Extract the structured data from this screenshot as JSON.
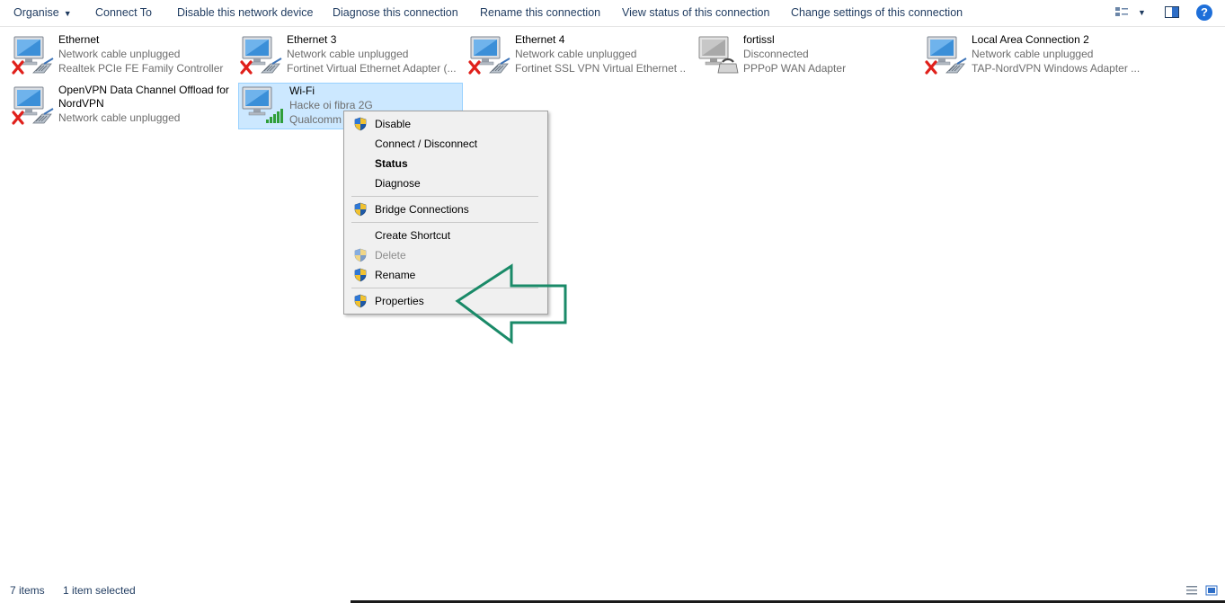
{
  "toolbar": {
    "organise": "Organise",
    "connect_to": "Connect To",
    "disable_device": "Disable this network device",
    "diagnose": "Diagnose this connection",
    "rename": "Rename this connection",
    "view_status": "View status of this connection",
    "change_settings": "Change settings of this connection",
    "help": "?"
  },
  "items": [
    {
      "name": "Ethernet",
      "status": "Network cable unplugged",
      "device": "Realtek PCIe FE Family Controller"
    },
    {
      "name": "Ethernet 3",
      "status": "Network cable unplugged",
      "device": "Fortinet Virtual Ethernet Adapter (..."
    },
    {
      "name": "Ethernet 4",
      "status": "Network cable unplugged",
      "device": "Fortinet SSL VPN Virtual Ethernet ..."
    },
    {
      "name": "fortissl",
      "status": "Disconnected",
      "device": "PPPoP WAN Adapter"
    },
    {
      "name": "Local Area Connection 2",
      "status": "Network cable unplugged",
      "device": "TAP-NordVPN Windows Adapter ..."
    },
    {
      "name": "OpenVPN Data Channel Offload for NordVPN",
      "status": "Network cable unplugged",
      "device": ""
    },
    {
      "name": "Wi-Fi",
      "status": "Hacke oi fibra 2G",
      "device": "Qualcomm"
    }
  ],
  "context_menu": {
    "disable": "Disable",
    "connect_disconnect": "Connect / Disconnect",
    "status": "Status",
    "diagnose": "Diagnose",
    "bridge": "Bridge Connections",
    "create_shortcut": "Create Shortcut",
    "delete": "Delete",
    "rename": "Rename",
    "properties": "Properties"
  },
  "statusbar": {
    "count": "7 items",
    "selected": "1 item selected"
  },
  "colors": {
    "selection_bg": "#cce8ff",
    "selection_border": "#99d1ff",
    "arrow": "#1a8a68",
    "help": "#1e6fd9"
  }
}
